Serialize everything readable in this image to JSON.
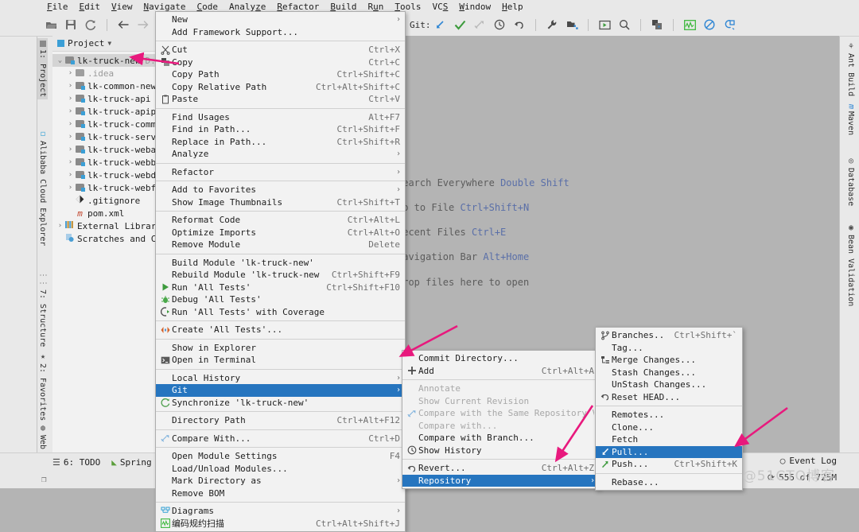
{
  "app": {
    "title": "IntelliJ IDEA",
    "accent_highlight": "#2675bf",
    "annotation_color": "#e8197d"
  },
  "menubar": {
    "items": [
      "File",
      "Edit",
      "View",
      "Navigate",
      "Code",
      "Analyze",
      "Refactor",
      "Build",
      "Run",
      "Tools",
      "VCS",
      "Window",
      "Help"
    ]
  },
  "toolbar": {
    "left_icons": [
      "open-folder-icon",
      "save-icon",
      "sync-icon",
      "back-arrow-icon",
      "forward-arrow-icon",
      "revert-icon"
    ],
    "git_label": "Git:",
    "git_icons": [
      "update-project-icon",
      "commit-icon",
      "compare-icon",
      "history-icon",
      "rollback-icon",
      "settings-wrench-icon",
      "run-config-icon",
      "run-icon",
      "search-icon",
      "copy-icon",
      "profiler-icon",
      "block-icon",
      "issue-icon"
    ]
  },
  "stripes": {
    "left": [
      {
        "label": "1: Project",
        "icon": "project-icon",
        "selected": true
      },
      {
        "label": "Alibaba Cloud Explorer",
        "icon": "cloud-icon",
        "selected": false
      },
      {
        "label": "7: Structure",
        "icon": "structure-icon",
        "selected": false
      },
      {
        "label": "2: Favorites",
        "icon": "star-icon",
        "selected": false
      },
      {
        "label": "Web",
        "icon": "web-icon",
        "selected": false
      }
    ],
    "right": [
      {
        "label": "Ant Build",
        "icon": "ant-icon"
      },
      {
        "label": "Maven",
        "icon": "maven-icon"
      },
      {
        "label": "Database",
        "icon": "database-icon"
      },
      {
        "label": "Bean Validation",
        "icon": "bean-icon"
      }
    ]
  },
  "project": {
    "header": "Project",
    "tree": [
      {
        "indent": 0,
        "twisty": "v",
        "icon": "module-folder-icon",
        "label": "lk-truck-new",
        "suffix": "D:\\",
        "selected": true
      },
      {
        "indent": 1,
        "twisty": ">",
        "icon": "folder-icon",
        "label": ".idea",
        "dim": true
      },
      {
        "indent": 1,
        "twisty": ">",
        "icon": "module-folder-icon",
        "label": "lk-common-new"
      },
      {
        "indent": 1,
        "twisty": ">",
        "icon": "module-folder-icon",
        "label": "lk-truck-api"
      },
      {
        "indent": 1,
        "twisty": ">",
        "icon": "module-folder-icon",
        "label": "lk-truck-apipr"
      },
      {
        "indent": 1,
        "twisty": ">",
        "icon": "module-folder-icon",
        "label": "lk-truck-commo"
      },
      {
        "indent": 1,
        "twisty": ">",
        "icon": "module-folder-icon",
        "label": "lk-truck-servi"
      },
      {
        "indent": 1,
        "twisty": ">",
        "icon": "module-folder-icon",
        "label": "lk-truck-webac"
      },
      {
        "indent": 1,
        "twisty": ">",
        "icon": "module-folder-icon",
        "label": "lk-truck-webba"
      },
      {
        "indent": 1,
        "twisty": ">",
        "icon": "module-folder-icon",
        "label": "lk-truck-webdr"
      },
      {
        "indent": 1,
        "twisty": ">",
        "icon": "module-folder-icon",
        "label": "lk-truck-webfi"
      },
      {
        "indent": 1,
        "twisty": "",
        "icon": "git-file-icon",
        "label": ".gitignore"
      },
      {
        "indent": 1,
        "twisty": "",
        "icon": "maven-file-icon",
        "label": "pom.xml"
      },
      {
        "indent": 0,
        "twisty": ">",
        "icon": "libraries-icon",
        "label": "External Librarie"
      },
      {
        "indent": 0,
        "twisty": "",
        "icon": "scratches-icon",
        "label": "Scratches and Con"
      }
    ]
  },
  "editor_hints": [
    {
      "text": "Search Everywhere",
      "key": "Double Shift"
    },
    {
      "text": "Go to File",
      "key": "Ctrl+Shift+N"
    },
    {
      "text": "Recent Files",
      "key": "Ctrl+E"
    },
    {
      "text": "Navigation Bar",
      "key": "Alt+Home"
    },
    {
      "text": "Drop files here to open",
      "key": ""
    }
  ],
  "context_menu": {
    "name": "project-context-menu",
    "items": [
      {
        "label": "New",
        "accel": "",
        "submenu": true,
        "icon": ""
      },
      {
        "label": "Add Framework Support...",
        "accel": "",
        "icon": ""
      },
      {
        "sep": true
      },
      {
        "label": "Cut",
        "accel": "Ctrl+X",
        "icon": "scissors-icon"
      },
      {
        "label": "Copy",
        "accel": "Ctrl+C",
        "icon": "copy-icon"
      },
      {
        "label": "Copy Path",
        "accel": "Ctrl+Shift+C",
        "icon": ""
      },
      {
        "label": "Copy Relative Path",
        "accel": "Ctrl+Alt+Shift+C",
        "icon": ""
      },
      {
        "label": "Paste",
        "accel": "Ctrl+V",
        "icon": "clipboard-icon"
      },
      {
        "sep": true
      },
      {
        "label": "Find Usages",
        "accel": "Alt+F7",
        "icon": ""
      },
      {
        "label": "Find in Path...",
        "accel": "Ctrl+Shift+F",
        "icon": ""
      },
      {
        "label": "Replace in Path...",
        "accel": "Ctrl+Shift+R",
        "icon": ""
      },
      {
        "label": "Analyze",
        "accel": "",
        "submenu": true,
        "icon": ""
      },
      {
        "sep": true
      },
      {
        "label": "Refactor",
        "accel": "",
        "submenu": true,
        "icon": ""
      },
      {
        "sep": true
      },
      {
        "label": "Add to Favorites",
        "accel": "",
        "submenu": true,
        "icon": ""
      },
      {
        "label": "Show Image Thumbnails",
        "accel": "Ctrl+Shift+T",
        "icon": ""
      },
      {
        "sep": true
      },
      {
        "label": "Reformat Code",
        "accel": "Ctrl+Alt+L",
        "icon": ""
      },
      {
        "label": "Optimize Imports",
        "accel": "Ctrl+Alt+O",
        "icon": ""
      },
      {
        "label": "Remove Module",
        "accel": "Delete",
        "icon": ""
      },
      {
        "sep": true
      },
      {
        "label": "Build Module 'lk-truck-new'",
        "accel": "",
        "icon": ""
      },
      {
        "label": "Rebuild Module 'lk-truck-new'",
        "accel": "Ctrl+Shift+F9",
        "icon": ""
      },
      {
        "label": "Run 'All Tests'",
        "accel": "Ctrl+Shift+F10",
        "icon": "run-icon"
      },
      {
        "label": "Debug 'All Tests'",
        "accel": "",
        "icon": "debug-icon"
      },
      {
        "label": "Run 'All Tests' with Coverage",
        "accel": "",
        "icon": "coverage-icon"
      },
      {
        "sep": true
      },
      {
        "label": "Create 'All Tests'...",
        "accel": "",
        "icon": "create-config-icon"
      },
      {
        "sep": true
      },
      {
        "label": "Show in Explorer",
        "accel": "",
        "icon": ""
      },
      {
        "label": "Open in Terminal",
        "accel": "",
        "icon": "terminal-icon"
      },
      {
        "sep": true
      },
      {
        "label": "Local History",
        "accel": "",
        "submenu": true,
        "icon": ""
      },
      {
        "label": "Git",
        "accel": "",
        "submenu": true,
        "icon": "",
        "highlighted": true
      },
      {
        "label": "Synchronize 'lk-truck-new'",
        "accel": "",
        "icon": "sync-icon"
      },
      {
        "sep": true
      },
      {
        "label": "Directory Path",
        "accel": "Ctrl+Alt+F12",
        "icon": ""
      },
      {
        "sep": true
      },
      {
        "label": "Compare With...",
        "accel": "Ctrl+D",
        "icon": "compare-icon"
      },
      {
        "sep": true
      },
      {
        "label": "Open Module Settings",
        "accel": "F4",
        "icon": ""
      },
      {
        "label": "Load/Unload Modules...",
        "accel": "",
        "icon": ""
      },
      {
        "label": "Mark Directory as",
        "accel": "",
        "submenu": true,
        "icon": ""
      },
      {
        "label": "Remove BOM",
        "accel": "",
        "icon": ""
      },
      {
        "sep": true
      },
      {
        "label": "Diagrams",
        "accel": "",
        "submenu": true,
        "icon": "diagram-icon"
      },
      {
        "label": "编码规约扫描",
        "accel": "Ctrl+Alt+Shift+J",
        "icon": "scan-icon"
      }
    ]
  },
  "git_submenu": {
    "name": "git-submenu",
    "items": [
      {
        "label": "Commit Directory...",
        "accel": "",
        "icon": ""
      },
      {
        "label": "Add",
        "accel": "Ctrl+Alt+A",
        "icon": "plus-icon"
      },
      {
        "sep": true
      },
      {
        "label": "Annotate",
        "accel": "",
        "icon": "",
        "disabled": true
      },
      {
        "label": "Show Current Revision",
        "accel": "",
        "icon": "",
        "disabled": true
      },
      {
        "label": "Compare with the Same Repository Version",
        "accel": "",
        "icon": "compare-icon",
        "disabled": true
      },
      {
        "label": "Compare with...",
        "accel": "",
        "icon": "",
        "disabled": true
      },
      {
        "label": "Compare with Branch...",
        "accel": "",
        "icon": ""
      },
      {
        "label": "Show History",
        "accel": "",
        "icon": "clock-icon"
      },
      {
        "sep": true
      },
      {
        "label": "Revert...",
        "accel": "Ctrl+Alt+Z",
        "icon": "revert-icon"
      },
      {
        "label": "Repository",
        "accel": "",
        "submenu": true,
        "icon": "",
        "highlighted": true
      }
    ]
  },
  "repository_submenu": {
    "name": "repository-submenu",
    "items": [
      {
        "label": "Branches...",
        "accel": "Ctrl+Shift+`",
        "icon": "branch-icon"
      },
      {
        "label": "Tag...",
        "accel": "",
        "icon": ""
      },
      {
        "label": "Merge Changes...",
        "accel": "",
        "icon": "merge-icon"
      },
      {
        "label": "Stash Changes...",
        "accel": "",
        "icon": ""
      },
      {
        "label": "UnStash Changes...",
        "accel": "",
        "icon": ""
      },
      {
        "label": "Reset HEAD...",
        "accel": "",
        "icon": "reset-icon"
      },
      {
        "sep": true
      },
      {
        "label": "Remotes...",
        "accel": "",
        "icon": ""
      },
      {
        "label": "Clone...",
        "accel": "",
        "icon": ""
      },
      {
        "label": "Fetch",
        "accel": "",
        "icon": ""
      },
      {
        "label": "Pull...",
        "accel": "",
        "icon": "pull-icon",
        "highlighted": true
      },
      {
        "label": "Push...",
        "accel": "Ctrl+Shift+K",
        "icon": "push-icon"
      },
      {
        "sep": true
      },
      {
        "label": "Rebase...",
        "accel": "",
        "icon": ""
      }
    ]
  },
  "statusbar": {
    "todo": "6: TODO",
    "spring": "Spring",
    "event_log": "Event Log",
    "memory": "555 of 725M"
  },
  "watermark": "@51CTO博客"
}
